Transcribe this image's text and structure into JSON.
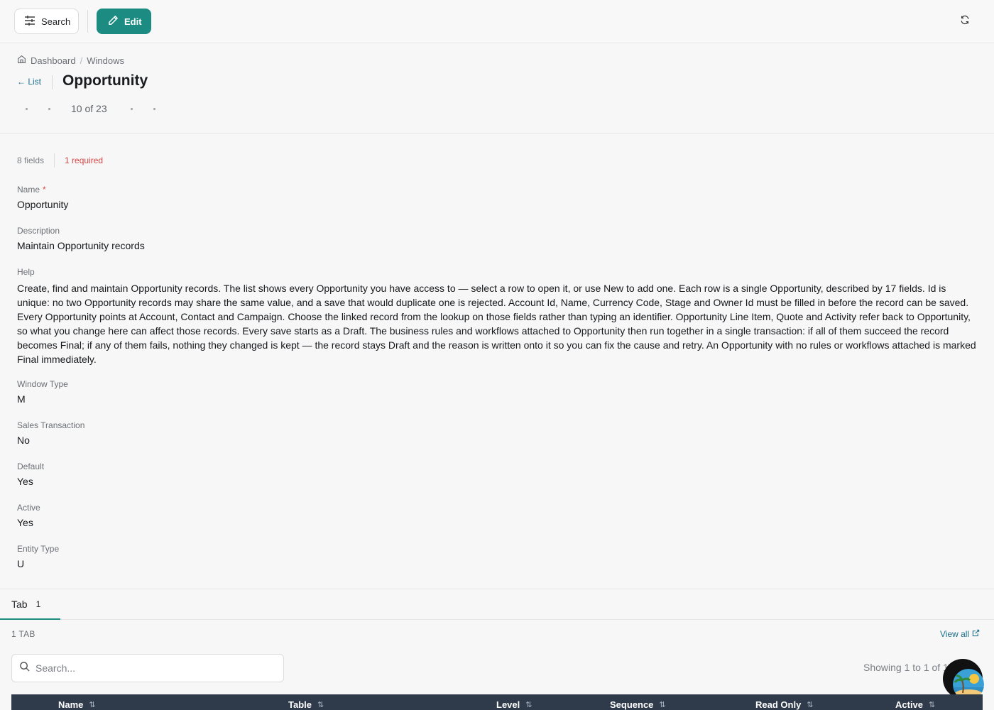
{
  "toolbar": {
    "search_label": "Search",
    "edit_label": "Edit"
  },
  "breadcrumb": {
    "items": [
      "Dashboard",
      "Windows"
    ],
    "separator": "/"
  },
  "header": {
    "back_label": "← List",
    "title": "Opportunity",
    "pager_text": "10 of 23"
  },
  "meta": {
    "fields_count": "8 fields",
    "required_count": "1 required"
  },
  "fields": {
    "name": {
      "label": "Name",
      "required_mark": "*",
      "value": "Opportunity"
    },
    "description": {
      "label": "Description",
      "value": "Maintain Opportunity records"
    },
    "help": {
      "label": "Help",
      "value": "Create, find and maintain Opportunity records. The list shows every Opportunity you have access to — select a row to open it, or use New to add one. Each row is a single Opportunity, described by 17 fields. Id is unique: no two Opportunity records may share the same value, and a save that would duplicate one is rejected. Account Id, Name, Currency Code, Stage and Owner Id must be filled in before the record can be saved. Every Opportunity points at Account, Contact and Campaign. Choose the linked record from the lookup on those fields rather than typing an identifier. Opportunity Line Item, Quote and Activity refer back to Opportunity, so what you change here can affect those records. Every save starts as a Draft. The business rules and workflows attached to Opportunity then run together in a single transaction: if all of them succeed the record becomes Final; if any of them fails, nothing they changed is kept — the record stays Draft and the reason is written onto it so you can fix the cause and retry. An Opportunity with no rules or workflows attached is marked Final immediately."
    },
    "window_type": {
      "label": "Window Type",
      "value": "M"
    },
    "sales_transaction": {
      "label": "Sales Transaction",
      "value": "No"
    },
    "default": {
      "label": "Default",
      "value": "Yes"
    },
    "active": {
      "label": "Active",
      "value": "Yes"
    },
    "entity_type": {
      "label": "Entity Type",
      "value": "U"
    }
  },
  "tabs": [
    {
      "label": "Tab",
      "count": "1"
    }
  ],
  "tab_section": {
    "count_label": "1 TAB",
    "view_all_label": "View all",
    "search_placeholder": "Search...",
    "showing_text": "Showing 1 to 1 of 1"
  },
  "table": {
    "columns": [
      "Name",
      "Table",
      "Level",
      "Sequence",
      "Read Only",
      "Active"
    ]
  },
  "colors": {
    "accent": "#1c8c83",
    "link": "#1c6f8c",
    "required": "#d64545",
    "table_header": "#2f3a4a"
  },
  "icons": {
    "search_button": "sliders-icon",
    "edit_button": "pencil-icon",
    "refresh": "refresh-icon",
    "breadcrumb_home": "home-icon",
    "search_field": "magnifier-icon",
    "view_all": "external-link-icon",
    "sort": "sort-icon"
  }
}
